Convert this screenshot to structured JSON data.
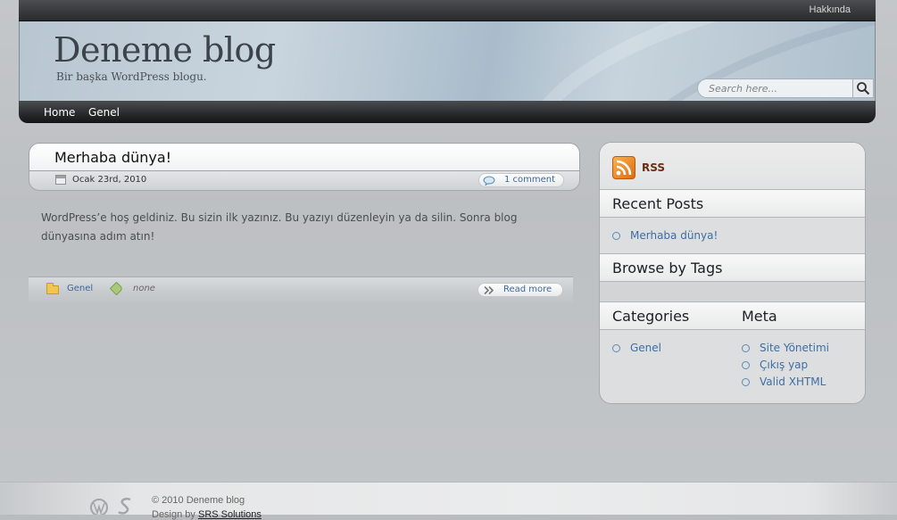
{
  "topbar": {
    "about_link": "Hakkında"
  },
  "header": {
    "blog_title": "Deneme blog",
    "blog_description": "Bir başka WordPress blogu.",
    "search_placeholder": "Search here..."
  },
  "nav": {
    "items": [
      "Home",
      "Genel"
    ]
  },
  "post": {
    "title": "Merhaba dünya!",
    "date": "Ocak 23rd, 2010",
    "comments": "1 comment",
    "body": "WordPress’e hoş geldiniz. Bu sizin ilk yazınız. Bu yazıyı düzenleyin ya da silin. Sonra blog dünyasına adım atın!",
    "category": "Genel",
    "tags": "none",
    "read_more": "Read more"
  },
  "sidebar": {
    "rss_label": "RSS",
    "recent_posts_title": "Recent Posts",
    "recent_posts": [
      "Merhaba dünya!"
    ],
    "tags_title": "Browse by Tags",
    "categories_title": "Categories",
    "categories": [
      "Genel"
    ],
    "meta_title": "Meta",
    "meta_links": [
      "Site Yönetimi",
      "Çıkış yap",
      "Valid XHTML"
    ]
  },
  "footer": {
    "copyright": "© 2010 Deneme blog",
    "credit_prefix": "Design by",
    "credit_link": "SRS Solutions"
  },
  "colors": {
    "link": "#3f6ea3",
    "rss": "#e06c10",
    "nav_bg": "#222325"
  }
}
